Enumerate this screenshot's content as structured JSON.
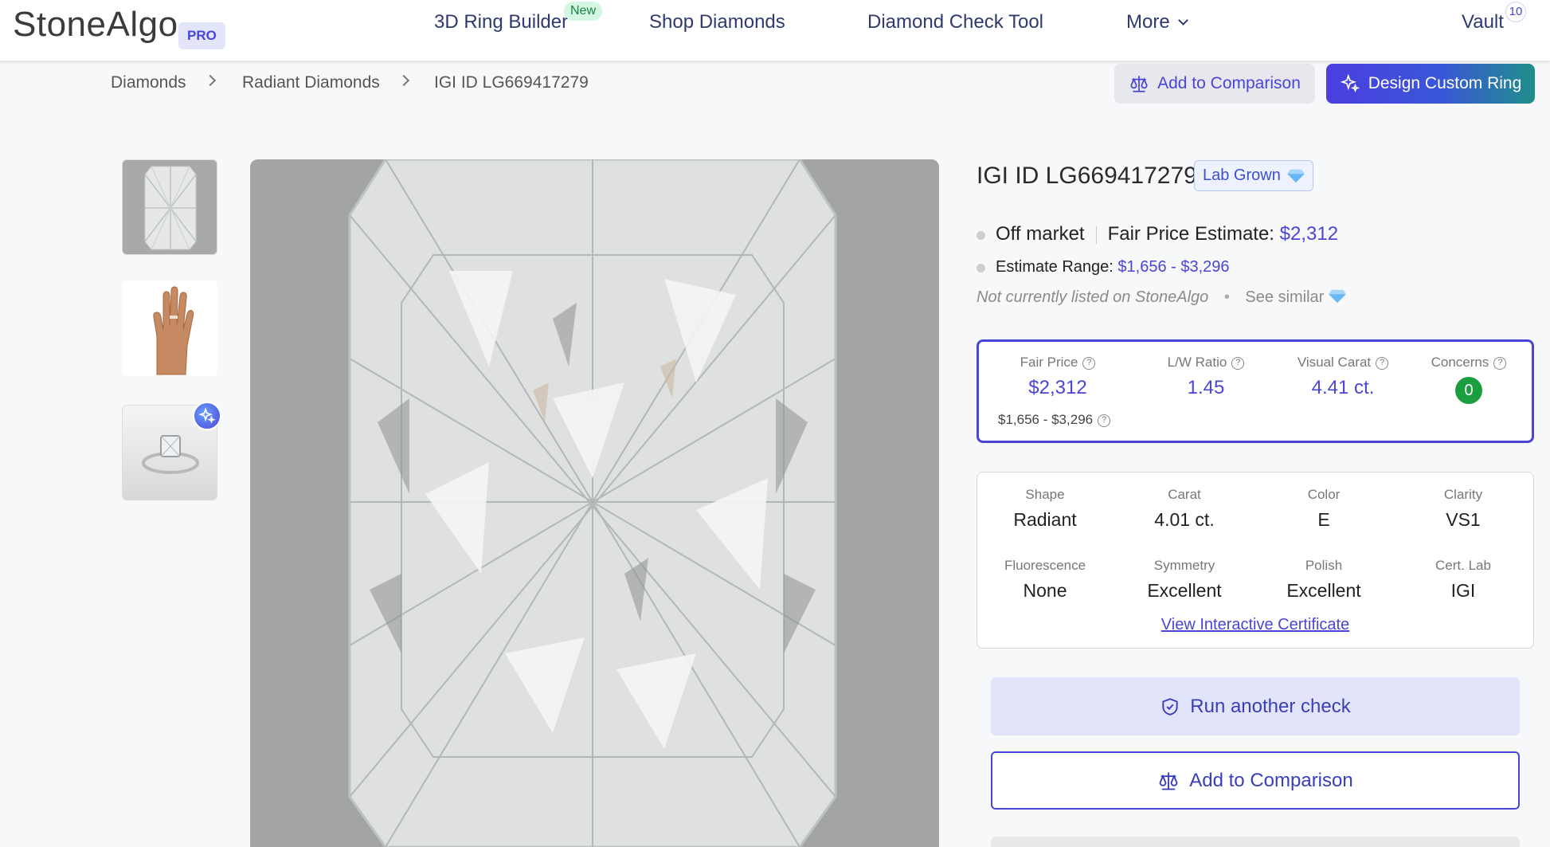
{
  "header": {
    "logo": "StoneAlgo",
    "pro_badge": "PRO",
    "nav": {
      "ring_builder": "3D Ring Builder",
      "new_badge": "New",
      "shop_diamonds": "Shop Diamonds",
      "check_tool": "Diamond Check Tool",
      "more": "More",
      "vault": "Vault",
      "vault_count": "10"
    }
  },
  "breadcrumb": [
    "Diamonds",
    "Radiant Diamonds",
    "IGI ID LG669417279"
  ],
  "actions": {
    "add_to_comparison": "Add to Comparison",
    "design_custom_ring": "Design Custom Ring"
  },
  "diamond": {
    "title": "IGI ID LG669417279",
    "badge": "Lab Grown",
    "status": "Off market",
    "fair_price_label": "Fair Price Estimate:",
    "fair_price_value": "$2,312",
    "estimate_range_label": "Estimate Range:",
    "estimate_range_value": "$1,656 - $3,296",
    "not_listed": "Not currently listed on StoneAlgo",
    "bullet": "•",
    "see_similar": "See similar"
  },
  "summary": {
    "fair_price_label": "Fair Price",
    "fair_price_value": "$2,312",
    "fair_price_range": "$1,656 - $3,296",
    "lw_ratio_label": "L/W Ratio",
    "lw_ratio_value": "1.45",
    "visual_carat_label": "Visual Carat",
    "visual_carat_value": "4.41 ct.",
    "concerns_label": "Concerns",
    "concerns_value": "0",
    "help_glyph": "?"
  },
  "specs": [
    {
      "label": "Shape",
      "value": "Radiant"
    },
    {
      "label": "Carat",
      "value": "4.01 ct."
    },
    {
      "label": "Color",
      "value": "E"
    },
    {
      "label": "Clarity",
      "value": "VS1"
    },
    {
      "label": "Fluorescence",
      "value": "None"
    },
    {
      "label": "Symmetry",
      "value": "Excellent"
    },
    {
      "label": "Polish",
      "value": "Excellent"
    },
    {
      "label": "Cert. Lab",
      "value": "IGI"
    }
  ],
  "certificate_link": "View Interactive Certificate",
  "buttons": {
    "run_check": "Run another check",
    "add_to_comparison": "Add to Comparison"
  },
  "colors": {
    "accent": "#4a45d6",
    "green": "#1a9e3f",
    "gradient_end": "#1f8f8a"
  }
}
